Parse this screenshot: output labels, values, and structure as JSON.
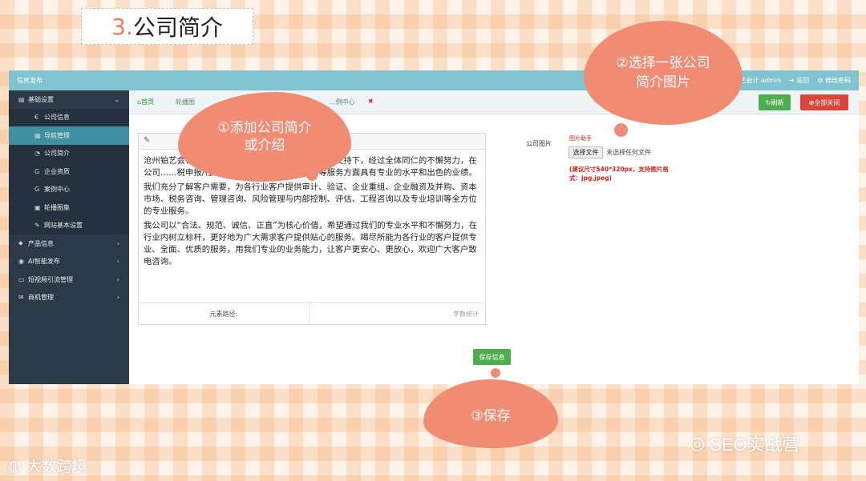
{
  "slide": {
    "title_num": "3.",
    "title_text": "公司简介"
  },
  "topbar": {
    "brand": "信息发布",
    "user": "...艺会计 admin",
    "return": "返回",
    "change_pw": "修改密码"
  },
  "sidebar": {
    "items": [
      {
        "label": "基础设置",
        "level": "top",
        "icon": "settings"
      },
      {
        "label": "公司信息",
        "level": "sub",
        "icon": "€"
      },
      {
        "label": "导航管理",
        "level": "sub",
        "icon": "▦",
        "active": true
      },
      {
        "label": "公司简介",
        "level": "sub",
        "icon": "◔"
      },
      {
        "label": "企业资质",
        "level": "sub",
        "icon": "G"
      },
      {
        "label": "案例中心",
        "level": "sub",
        "icon": "G"
      },
      {
        "label": "轮播图集",
        "level": "sub",
        "icon": "▣"
      },
      {
        "label": "网站基本设置",
        "level": "sub",
        "icon": "✎"
      },
      {
        "label": "产品信息",
        "level": "top",
        "icon": "tag"
      },
      {
        "label": "AI智能发布",
        "level": "top",
        "icon": "pin"
      },
      {
        "label": "短视频引流管理",
        "level": "top",
        "icon": "card"
      },
      {
        "label": "商机管理",
        "level": "top",
        "icon": "mail"
      }
    ]
  },
  "tabs": {
    "home": "首页",
    "t2": "轮播图",
    "t3": "...例中心",
    "close": "✖"
  },
  "actions": {
    "refresh": "刷新",
    "close_all": "全部关闭"
  },
  "editor": {
    "paragraphs": [
      "沧州铂艺会计事务所有限公司……，在社会各界大力支持下，经过全体同仁的不懈努力，在公司……税申报/社代理/商标注册/审计验资评估等服务方面具有专业的水平和出色的业绩。",
      "我们充分了解客户需要，为各行业客户提供审计、验证、企业重组、企业融资及并购、资本市场、税务咨询、管理咨询、风险管理与内部控制、评估、工程咨询以及专业培训等全方位的专业服务。",
      "我公司以“合法、规范、诚信、正直”为核心价值，希望通过我们的专业水平和不懈努力，在行业内树立标杆，更好地为广大需求客户提供贴心的服务。竭尽所能为各行业的客户提供专业、全面、优质的服务，用我们专业的业务能力，让客户更安心、更放心，欢迎广大客户致电咨询。"
    ],
    "path_label": "元素路径:",
    "count_label": "字数统计"
  },
  "image": {
    "label": "公司图片",
    "helper": "图片助手",
    "file_btn": "选择文件",
    "file_none": "未选择任何文件",
    "tip": "(建议尺寸540*320px，支持图片格式：jpg,jpeg)"
  },
  "save": {
    "label": "保存信息"
  },
  "callouts": {
    "c1": "①添加公司简介或介绍",
    "c2": "②选择一张公司简介图片",
    "c3": "③保存"
  },
  "watermarks": {
    "wechat": "SEO实战营",
    "brand": "大数跨境"
  }
}
